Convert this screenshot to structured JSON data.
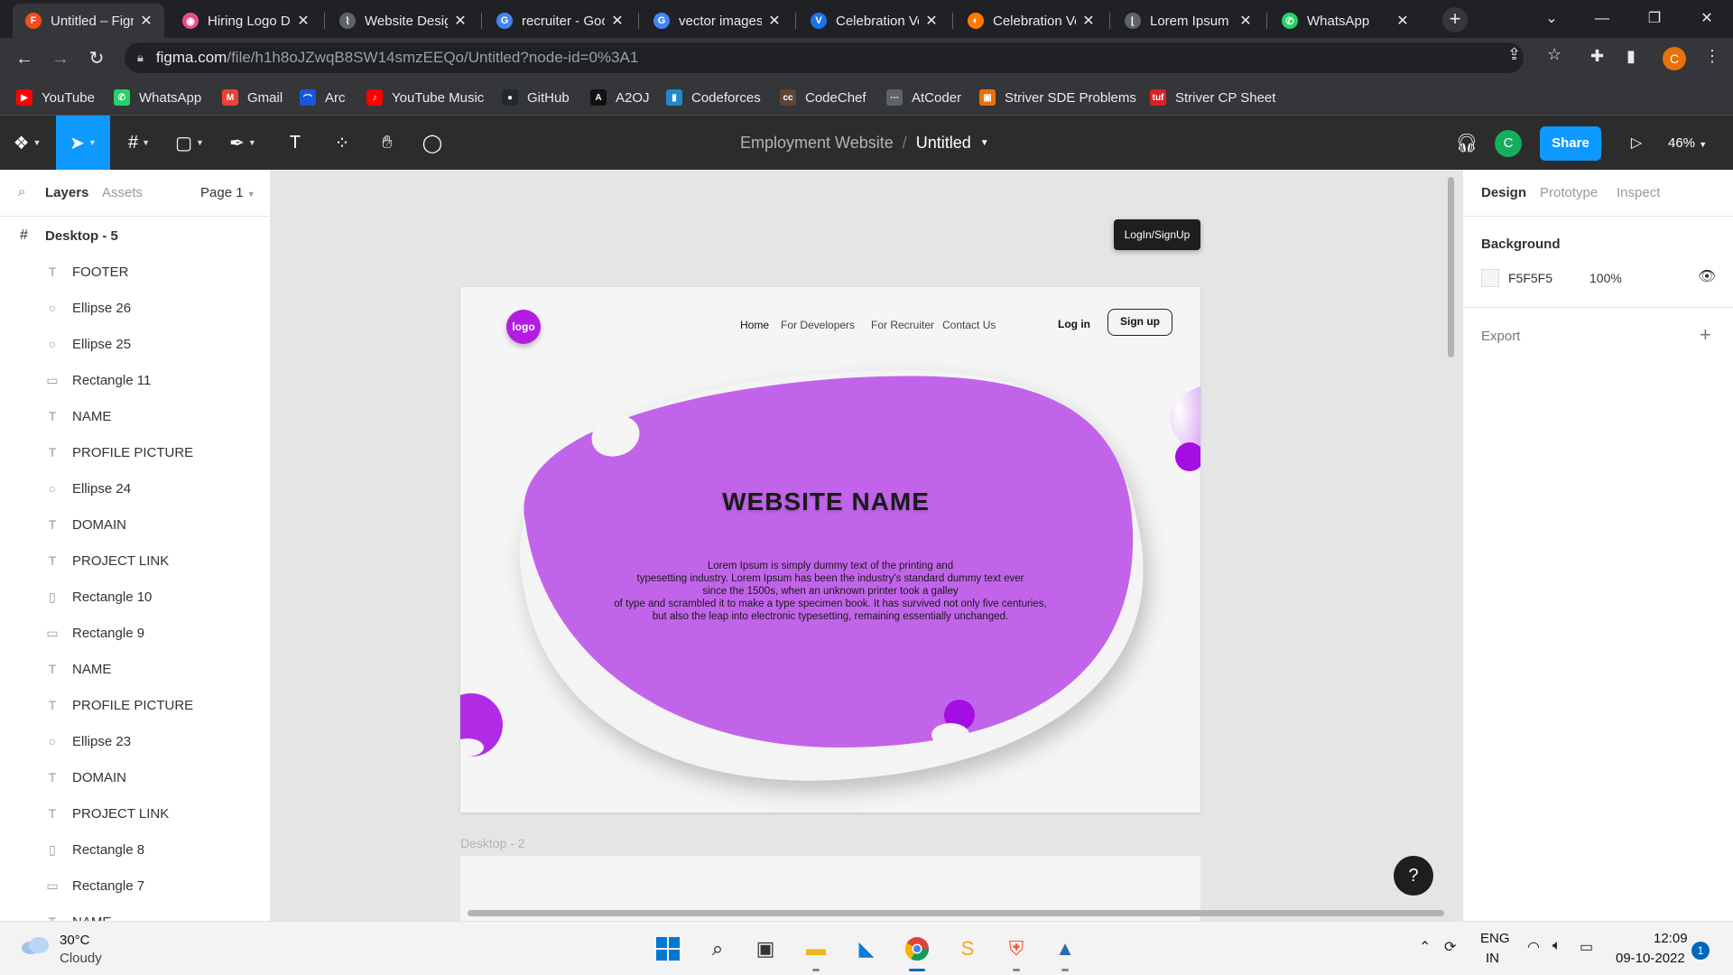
{
  "browser": {
    "tabs": [
      {
        "label": "Untitled – Figma",
        "icon": "figma-icon",
        "color": "#f24e1e",
        "glyph": "F"
      },
      {
        "label": "Hiring Logo Designs",
        "icon": "dribbble-icon",
        "color": "#ea4c89",
        "glyph": "◉"
      },
      {
        "label": "Website Design",
        "icon": "website-icon",
        "color": "#5f6368",
        "glyph": "⌇"
      },
      {
        "label": "recruiter - Google",
        "icon": "google-icon",
        "color": "#4285f4",
        "glyph": "G"
      },
      {
        "label": "vector images",
        "icon": "google-icon",
        "color": "#4285f4",
        "glyph": "G"
      },
      {
        "label": "Celebration Vector",
        "icon": "vector-icon",
        "color": "#1a73e8",
        "glyph": "V"
      },
      {
        "label": "Celebration Vector",
        "icon": "vector-icon",
        "color": "#ff7a00",
        "glyph": "◐"
      },
      {
        "label": "Lorem Ipsum",
        "icon": "lorem-icon",
        "color": "#5f6368",
        "glyph": "⌊"
      },
      {
        "label": "WhatsApp",
        "icon": "whatsapp-icon",
        "color": "#25d366",
        "glyph": "✆"
      }
    ],
    "url_host": "figma.com",
    "url_path": "/file/h1h8oJZwqB8SW14smzEEQo/Untitled?node-id=0%3A1",
    "profile_initial": "C",
    "bookmarks": [
      {
        "label": "YouTube",
        "icon": "youtube-icon",
        "color": "#ff0000",
        "glyph": "▶"
      },
      {
        "label": "WhatsApp",
        "icon": "whatsapp-icon",
        "color": "#25d366",
        "glyph": "✆"
      },
      {
        "label": "Gmail",
        "icon": "gmail-icon",
        "color": "#ea4335",
        "glyph": "M"
      },
      {
        "label": "Arc",
        "icon": "arc-icon",
        "color": "#1a56db",
        "glyph": "⌒"
      },
      {
        "label": "YouTube Music",
        "icon": "youtube-music-icon",
        "color": "#ff0000",
        "glyph": "♪"
      },
      {
        "label": "GitHub",
        "icon": "github-icon",
        "color": "#24292e",
        "glyph": "●"
      },
      {
        "label": "A2OJ",
        "icon": "a2oj-icon",
        "color": "#111111",
        "glyph": "A"
      },
      {
        "label": "Codeforces",
        "icon": "codeforces-icon",
        "color": "#1f8acb",
        "glyph": "▮"
      },
      {
        "label": "CodeChef",
        "icon": "codechef-icon",
        "color": "#5b4638",
        "glyph": "cc"
      },
      {
        "label": "AtCoder",
        "icon": "atcoder-icon",
        "color": "#5f6368",
        "glyph": "⋯"
      },
      {
        "label": "Striver SDE Problems",
        "icon": "striver-icon",
        "color": "#e8710a",
        "glyph": "▣"
      },
      {
        "label": "Striver CP Sheet",
        "icon": "tuf-icon",
        "color": "#d92027",
        "glyph": "tuf"
      }
    ]
  },
  "figma": {
    "project": "Employment Website",
    "file": "Untitled",
    "avatar_initial": "C",
    "share_label": "Share",
    "zoom": "46%",
    "left_panel": {
      "tab_layers": "Layers",
      "tab_assets": "Assets",
      "page": "Page 1",
      "frame": "Desktop - 5",
      "layers": [
        {
          "name": "FOOTER",
          "type": "text"
        },
        {
          "name": "Ellipse 26",
          "type": "ellipse"
        },
        {
          "name": "Ellipse 25",
          "type": "ellipse"
        },
        {
          "name": "Rectangle 11",
          "type": "rect"
        },
        {
          "name": "NAME",
          "type": "text"
        },
        {
          "name": "PROFILE PICTURE",
          "type": "text"
        },
        {
          "name": "Ellipse 24",
          "type": "ellipse"
        },
        {
          "name": "DOMAIN",
          "type": "text"
        },
        {
          "name": "PROJECT LINK",
          "type": "text"
        },
        {
          "name": "Rectangle 10",
          "type": "rect-v"
        },
        {
          "name": "Rectangle 9",
          "type": "rect"
        },
        {
          "name": "NAME",
          "type": "text"
        },
        {
          "name": "PROFILE PICTURE",
          "type": "text"
        },
        {
          "name": "Ellipse 23",
          "type": "ellipse"
        },
        {
          "name": "DOMAIN",
          "type": "text"
        },
        {
          "name": "PROJECT LINK",
          "type": "text"
        },
        {
          "name": "Rectangle 8",
          "type": "rect-v"
        },
        {
          "name": "Rectangle 7",
          "type": "rect"
        },
        {
          "name": "NAME",
          "type": "text"
        }
      ]
    },
    "canvas": {
      "tooltip": "LogIn/SignUp",
      "frame2_label": "Desktop - 2",
      "design": {
        "logo": "logo",
        "nav": [
          "Home",
          "For Developers",
          "For Recruiter",
          "Contact Us"
        ],
        "login": "Log in",
        "signup": "Sign up",
        "title": "WEBSITE  NAME",
        "body_lines": [
          "Lorem Ipsum is simply dummy text of the printing and",
          "typesetting industry. Lorem Ipsum has been the industry's standard dummy text ever",
          "since the 1500s, when an unknown printer took a galley",
          "of type and scrambled it to make a type specimen book. It has survived not only five centuries,",
          "but also the leap into electronic typesetting, remaining essentially unchanged."
        ],
        "accent_color": "#c264ea",
        "deep_purple": "#a72ee0"
      }
    },
    "right_panel": {
      "tab_design": "Design",
      "tab_prototype": "Prototype",
      "tab_inspect": "Inspect",
      "background_title": "Background",
      "bg_hex": "F5F5F5",
      "bg_opacity": "100%",
      "export_title": "Export"
    },
    "help": "?"
  },
  "taskbar": {
    "temp": "30°C",
    "weather": "Cloudy",
    "lang1": "ENG",
    "lang2": "IN",
    "time": "12:09",
    "date": "09-10-2022",
    "notifications": "1"
  }
}
